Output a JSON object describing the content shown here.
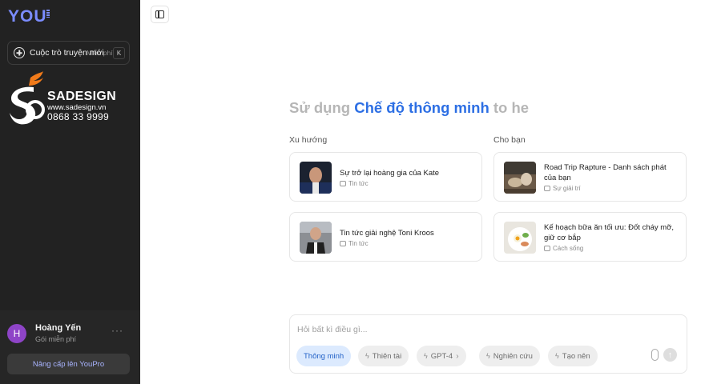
{
  "sidebar": {
    "logo": "YOU",
    "new_chat_label": "Cuộc trò truyện mới",
    "new_chat_shortcut": "Miễn phí",
    "new_chat_key": "K",
    "watermark": {
      "title": "SADESIGN",
      "url": "www.sadesign.vn",
      "phone": "0868 33 9999"
    },
    "user": {
      "initial": "H",
      "name": "Hoàng Yến",
      "plan": "Gói miễn phí",
      "menu": "···"
    },
    "upgrade_label": "Nâng cấp lên YouPro"
  },
  "main": {
    "headline_prefix": "Sử dụng ",
    "headline_highlight": "Chế độ thông minh",
    "headline_suffix": " to he",
    "sections": {
      "trending": "Xu hướng",
      "for_you": "Cho bạn"
    },
    "cards": [
      {
        "title": "Sự trở lại hoàng gia của Kate",
        "category": "Tin tức"
      },
      {
        "title": "Road Trip Rapture - Danh sách phát của bạn",
        "category": "Sự giải trí"
      },
      {
        "title": "Tin tức giải nghệ Toni Kroos",
        "category": "Tin tức"
      },
      {
        "title": "Kế hoạch bữa ăn tối ưu: Đốt cháy mỡ, giữ cơ bắp",
        "category": "Cách sống"
      }
    ],
    "input": {
      "placeholder": "Hỏi bất kì điều gì...",
      "modes": [
        {
          "label": "Thông minh",
          "active": true
        },
        {
          "label": "Thiên tài",
          "active": false
        },
        {
          "label": "GPT-4",
          "active": false
        },
        {
          "label": "Nghiên cứu",
          "active": false
        },
        {
          "label": "Tạo nên",
          "active": false
        }
      ]
    }
  },
  "colors": {
    "sidebar_bg": "#222222",
    "accent_blue": "#2d6fe4",
    "logo": "#7b8cff",
    "avatar": "#8e44c7",
    "watermark_orange": "#f07a1a"
  },
  "icons": [
    "plus-circle-icon",
    "panel-toggle-icon",
    "news-icon",
    "entertainment-icon",
    "lifestyle-icon",
    "bolt-icon",
    "chevron-right-icon",
    "paperclip-icon",
    "send-arrow-icon"
  ]
}
